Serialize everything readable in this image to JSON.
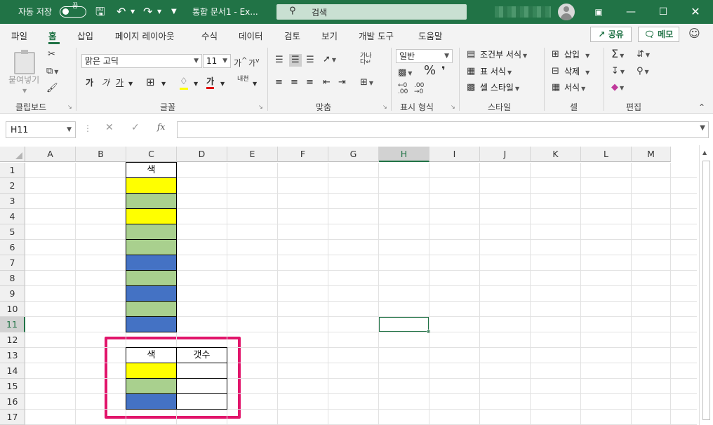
{
  "titlebar": {
    "autosave": "자동 저장",
    "toggle_state": "끔",
    "doc_title": "통합 문서1 - Ex...",
    "search_placeholder": "검색"
  },
  "tabs": [
    "파일",
    "홈",
    "삽입",
    "페이지 레이아웃",
    "수식",
    "데이터",
    "검토",
    "보기",
    "개발 도구",
    "도움말"
  ],
  "share_label": "공유",
  "memo_label": "메모",
  "ribbon": {
    "paste_label": "붙여넣기",
    "clipboard_group": "클립보드",
    "font_name": "맑은 고딕",
    "font_size": "11",
    "font_group": "글꼴",
    "bold_label": "가",
    "italic_label": "가",
    "underline_label": "가",
    "font_color_label": "가",
    "align_group": "맞춤",
    "number_format": "일반",
    "number_group": "표시 형식",
    "cond_format": "조건부 서식",
    "table_format": "표 서식",
    "cell_style": "셀 스타일",
    "style_group": "스타일",
    "insert_label": "삽입",
    "delete_label": "삭제",
    "format_label": "서식",
    "cells_group": "셀",
    "edit_group": "편집"
  },
  "formula_bar": {
    "name_box": "H11",
    "formula": ""
  },
  "columns": [
    "A",
    "B",
    "C",
    "D",
    "E",
    "F",
    "G",
    "H",
    "I",
    "J",
    "K",
    "L",
    "M"
  ],
  "rows": [
    "1",
    "2",
    "3",
    "4",
    "5",
    "6",
    "7",
    "8",
    "9",
    "10",
    "11",
    "12",
    "13",
    "14",
    "15",
    "16",
    "17"
  ],
  "colors": {
    "accent": "#217346",
    "yellow": "#FFFF00",
    "green": "#A9D08E",
    "blue": "#4472C4",
    "highlight": "#E1156B"
  },
  "sheet": {
    "c1_header": "색",
    "column_c_fills": [
      "yellow",
      "green",
      "yellow",
      "green",
      "green",
      "blue",
      "green",
      "blue",
      "green",
      "blue"
    ],
    "summary_header_color": "색",
    "summary_header_count": "갯수",
    "summary_fills": [
      "yellow",
      "green",
      "blue"
    ]
  }
}
